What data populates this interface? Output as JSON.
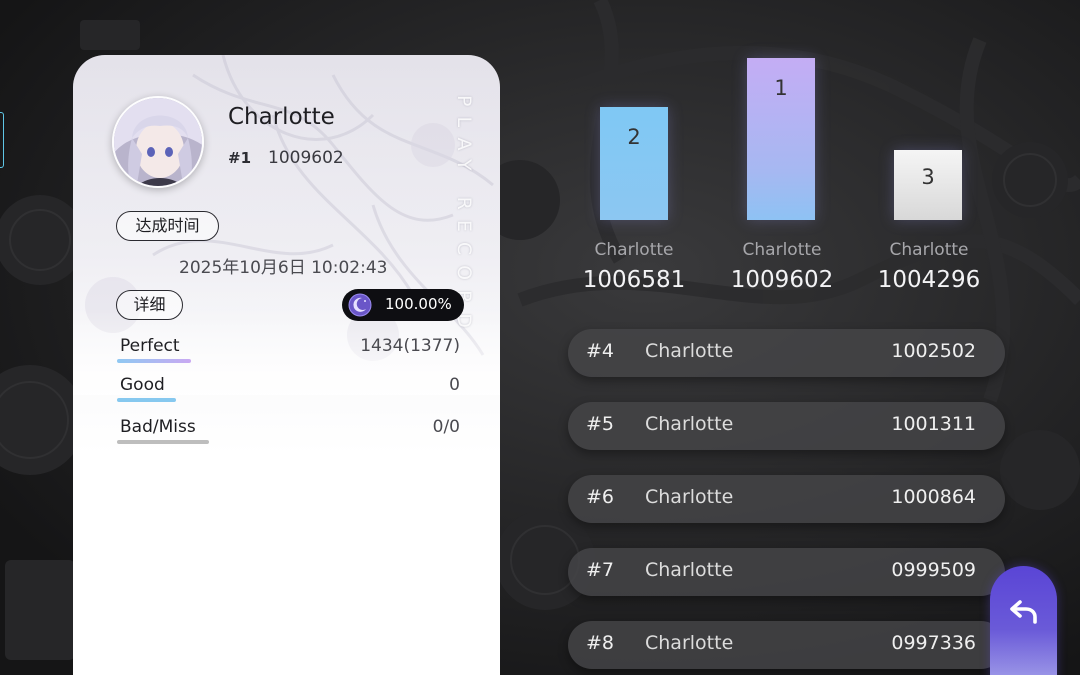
{
  "card": {
    "vertical_text": "PLAY RECORD",
    "player": {
      "name": "Charlotte",
      "rank": "#1",
      "score": "1009602"
    },
    "achieve_label": "达成时间",
    "achieve_time": "2025年10月6日 10:02:43",
    "detail_label": "详细",
    "accuracy": "100.00%",
    "judgements": [
      {
        "label": "Perfect",
        "value": "1434(1377)"
      },
      {
        "label": "Good",
        "value": "0"
      },
      {
        "label": "Bad/Miss",
        "value": "0/0"
      }
    ]
  },
  "podium": [
    {
      "place": "2",
      "name": "Charlotte",
      "score": "1006581"
    },
    {
      "place": "1",
      "name": "Charlotte",
      "score": "1009602"
    },
    {
      "place": "3",
      "name": "Charlotte",
      "score": "1004296"
    }
  ],
  "rankings": [
    {
      "rank": "#4",
      "name": "Charlotte",
      "score": "1002502"
    },
    {
      "rank": "#5",
      "name": "Charlotte",
      "score": "1001311"
    },
    {
      "rank": "#6",
      "name": "Charlotte",
      "score": "1000864"
    },
    {
      "rank": "#7",
      "name": "Charlotte",
      "score": "0999509"
    },
    {
      "rank": "#8",
      "name": "Charlotte",
      "score": "0997336"
    }
  ],
  "icons": {
    "accuracy": "moon-icon",
    "back": "back-arrow-icon"
  },
  "colors": {
    "podium_first": "#c4adf4",
    "podium_second": "#7fc8f4",
    "podium_third": "#f5f5f5",
    "back_button": "#5a45d6"
  }
}
